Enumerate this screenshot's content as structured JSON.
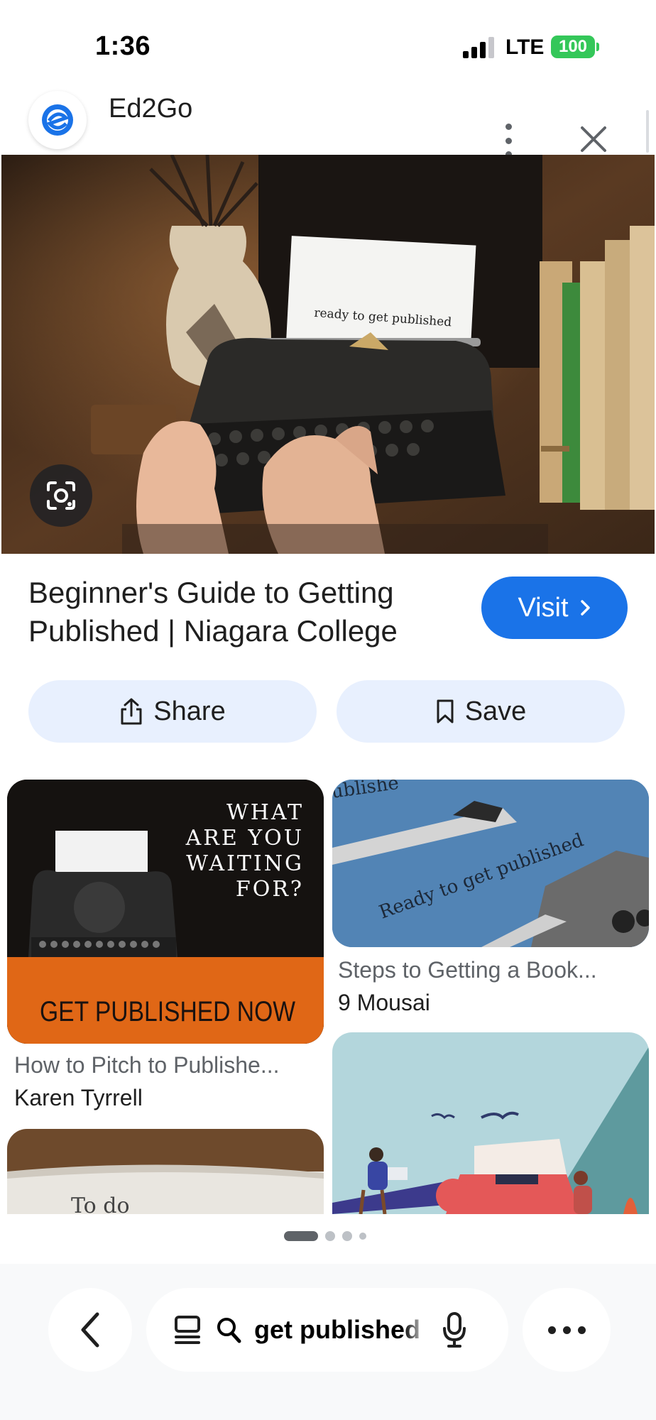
{
  "status_bar": {
    "time": "1:36",
    "network": "LTE",
    "battery": "100"
  },
  "source": {
    "name": "Ed2Go",
    "logo_icon": "ed2go-logo-icon"
  },
  "hero": {
    "typed_text": "ready to get published",
    "lens_icon": "google-lens-icon"
  },
  "result": {
    "title": "Beginner's Guide to Getting Published | Niagara College",
    "visit_label": "Visit",
    "share_label": "Share",
    "save_label": "Save"
  },
  "related": [
    {
      "title": "How to Pitch to Publishe...",
      "source": "Karen Tyrrell",
      "overlay_lines": [
        "WHAT",
        "ARE YOU",
        "WAITING",
        "FOR?"
      ],
      "banner": "GET PUBLISHED NOW"
    },
    {
      "title": "Steps to Getting a Book...",
      "source": "9 Mousai",
      "overlay_text": "Ready to get published",
      "corner_text": "ublishe"
    },
    {
      "title": "",
      "source": "",
      "overlay_text": "To do"
    },
    {
      "title": "",
      "source": ""
    }
  ],
  "pagination": {
    "active": 0,
    "count": 4
  },
  "bottom_bar": {
    "search_query": "get published"
  },
  "colors": {
    "accent": "#1a73e8",
    "pill_bg": "#e8f0fe",
    "battery": "#34c759"
  }
}
